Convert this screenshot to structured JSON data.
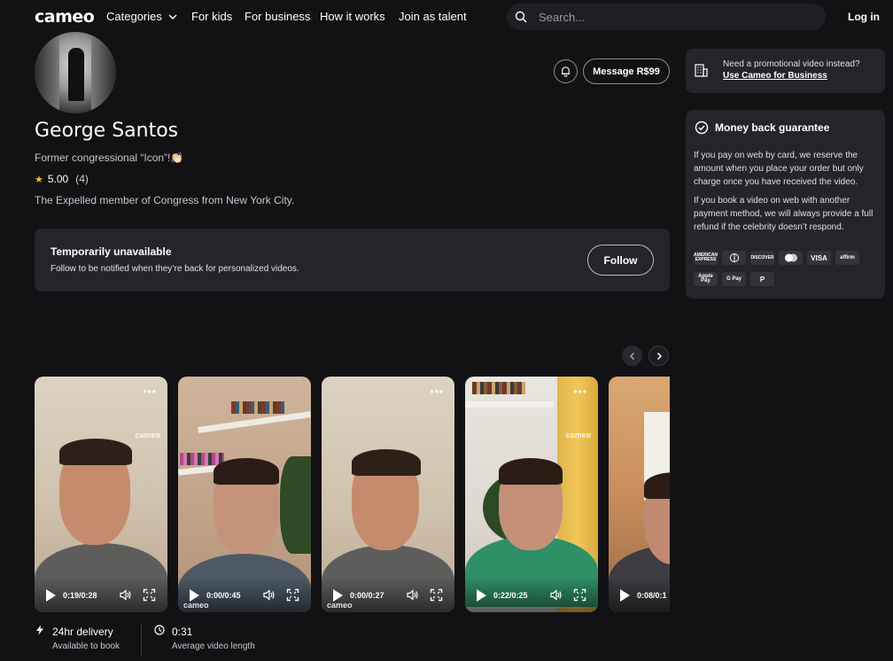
{
  "header": {
    "logo": "cameo",
    "nav": {
      "categories": "Categories",
      "kids": "For kids",
      "business": "For business",
      "how": "How it works",
      "join": "Join as talent"
    },
    "search_placeholder": "Search...",
    "login": "Log in"
  },
  "profile": {
    "name": "George Santos",
    "tagline": "Former congressional “Icon”!👏🏻",
    "rating": "5.00",
    "rating_count": "(4)",
    "bio": "The Expelled member of Congress from New York City.",
    "message_button": "Message R$99"
  },
  "unavailable": {
    "title": "Temporarily unavailable",
    "subtitle": "Follow to be notified when they’re back for personalized videos.",
    "follow_button": "Follow"
  },
  "videos": [
    {
      "time": "0:19/0:28",
      "watermark": "cameo",
      "theme": "beige"
    },
    {
      "time": "0:00/0:45",
      "watermark": "cameo",
      "theme": "shelf"
    },
    {
      "time": "0:00/0:27",
      "watermark": "cameo",
      "theme": "beige"
    },
    {
      "time": "0:22/0:25",
      "watermark": "cameo",
      "theme": "green"
    },
    {
      "time": "0:08/0:1",
      "watermark": "",
      "theme": "warm"
    }
  ],
  "stats": {
    "delivery_title": "24hr delivery",
    "delivery_sub": "Available to book",
    "length_title": "0:31",
    "length_sub": "Average video length"
  },
  "promo": {
    "question": "Need a promotional video instead?",
    "link": "Use Cameo for Business"
  },
  "guarantee": {
    "title": "Money back guarantee",
    "p1": "If you pay on web by card, we reserve the amount when you place your order but only charge once you have received the video.",
    "p2": "If you book a video on web with another payment method, we will always provide a full refund if the celebrity doesn’t respond.",
    "payment_methods": [
      "AMERICAN EXPRESS",
      "Diners",
      "DISCOVER",
      "mastercard",
      "VISA",
      "affirm",
      "Apple Pay",
      "G Pay",
      "PayPal"
    ]
  },
  "colors": {
    "background": "#121114",
    "card": "#25242a",
    "star": "#f5c518"
  }
}
